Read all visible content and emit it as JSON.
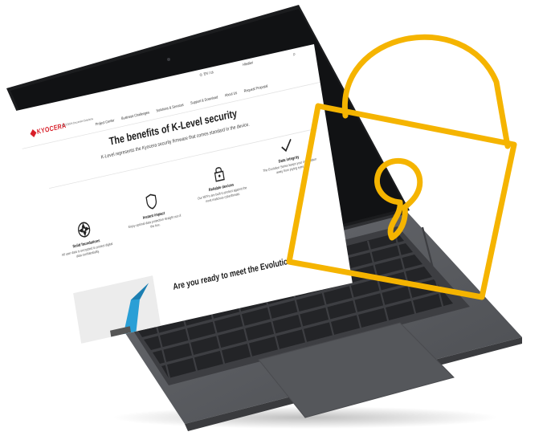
{
  "utility_bar": {
    "language": "EN / cs",
    "search_hint": "Hledání"
  },
  "header": {
    "logo_text": "KYOCERA",
    "logo_subtext": "KYOCERA Document Solutions",
    "nav": [
      "Project Center",
      "Business Challenges",
      "Solutions & Services",
      "Support & Download",
      "About Us",
      "Request Proposal"
    ]
  },
  "hero": {
    "title": "The benefits of K-Level security",
    "subtitle": "K-Level represents the Kyocera security firmware that comes standard in the device."
  },
  "features": [
    {
      "icon": "shutter-icon",
      "title": "Solid foundations",
      "desc": "All user data is encrypted to protect digital data confidentiality."
    },
    {
      "icon": "shield-icon",
      "title": "Instant impact",
      "desc": "Enjoy optimal data protection straight out of the box."
    },
    {
      "icon": "lock-icon",
      "title": "Reliable devices",
      "desc": "Our MFPs are built to protect against the most malicious cyberthreats."
    },
    {
      "icon": "check-icon",
      "title": "Data integrity",
      "desc": "The Evolution Series keeps your information away from prying eyes."
    }
  ],
  "evolution": {
    "title": "Are you ready to meet the Evolution"
  },
  "colors": {
    "lock_outline": "#f5b400",
    "brand_red": "#d81e28",
    "laptop_body": "#5b5d62",
    "keyboard_key": "#2b2c2f"
  }
}
